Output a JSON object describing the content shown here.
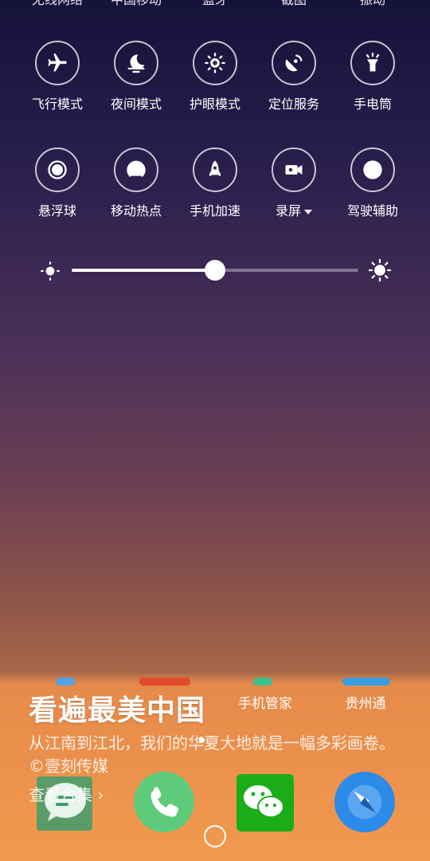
{
  "top_row_labels": [
    "无线网络",
    "中国移动",
    "蓝牙",
    "截图",
    "振动"
  ],
  "tiles_row1": [
    {
      "label": "飞行模式",
      "icon": "airplane-icon"
    },
    {
      "label": "夜间模式",
      "icon": "moon-icon"
    },
    {
      "label": "护眼模式",
      "icon": "eye-care-icon"
    },
    {
      "label": "定位服务",
      "icon": "location-icon"
    },
    {
      "label": "手电筒",
      "icon": "flashlight-icon"
    }
  ],
  "tiles_row2": [
    {
      "label": "悬浮球",
      "icon": "floating-ball-icon"
    },
    {
      "label": "移动热点",
      "icon": "hotspot-icon"
    },
    {
      "label": "手机加速",
      "icon": "rocket-icon"
    },
    {
      "label": "录屏",
      "icon": "screen-record-icon"
    },
    {
      "label": "驾驶辅助",
      "icon": "steering-wheel-icon"
    }
  ],
  "brightness": {
    "level": 0.5
  },
  "home_apps": [
    "手机管家",
    "贵州通"
  ],
  "banner": {
    "title": "看遍最美中国",
    "description": "从江南到江北，我们的华夏大地就是一幅多彩画卷。©壹刻传媒",
    "link": "查看合集"
  },
  "dock": [
    "messages-app-icon",
    "phone-app-icon",
    "wechat-app-icon",
    "browser-app-icon"
  ],
  "colors": {
    "accent_orange": "#f2994e",
    "wechat_green": "#1aad19",
    "phone_green": "#5dcb7a",
    "browser_blue": "#2c8be8"
  }
}
